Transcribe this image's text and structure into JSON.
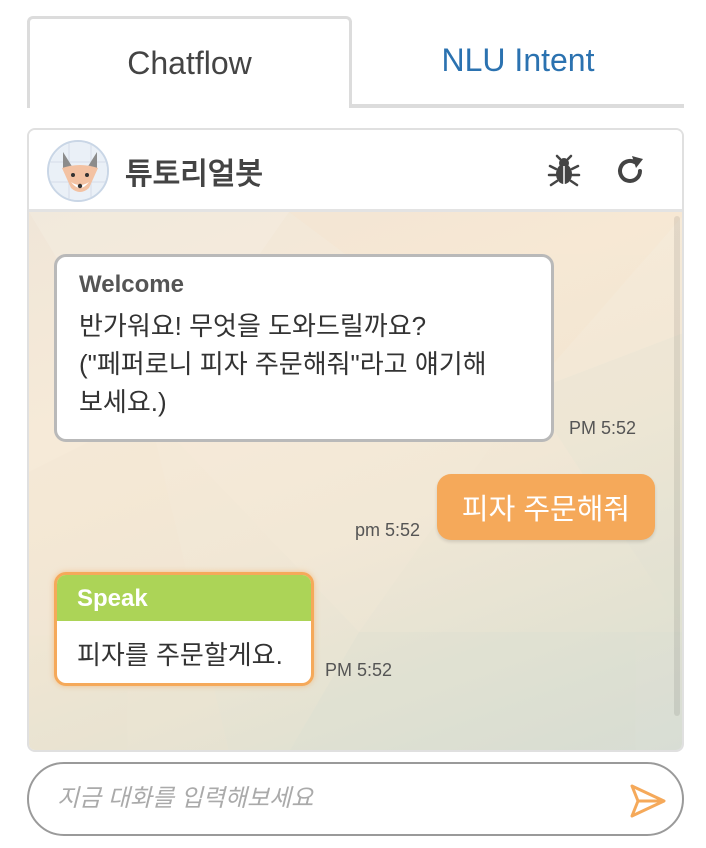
{
  "tabs": [
    {
      "label": "Chatflow",
      "active": true
    },
    {
      "label": "NLU Intent",
      "active": false
    }
  ],
  "header": {
    "bot_name": "튜토리얼봇",
    "icons": [
      "fox-avatar-icon",
      "bug-icon",
      "refresh-icon"
    ]
  },
  "messages": {
    "welcome": {
      "title": "Welcome",
      "text": "반가워요! 무엇을 도와드릴까요?\n(\"페퍼로니 피자 주문해줘\"라고 얘기해\n보세요.)",
      "time": "PM 5:52"
    },
    "user": {
      "text": "피자 주문해줘",
      "time": "pm 5:52"
    },
    "speak": {
      "title": "Speak",
      "text": "피자를 주문할게요.",
      "time": "PM 5:52"
    }
  },
  "input": {
    "placeholder": "지금 대화를 입력해보세요",
    "value": ""
  },
  "colors": {
    "accent_orange": "#f5a95a",
    "speak_green": "#acd457",
    "tab_link_blue": "#2b72b0"
  }
}
